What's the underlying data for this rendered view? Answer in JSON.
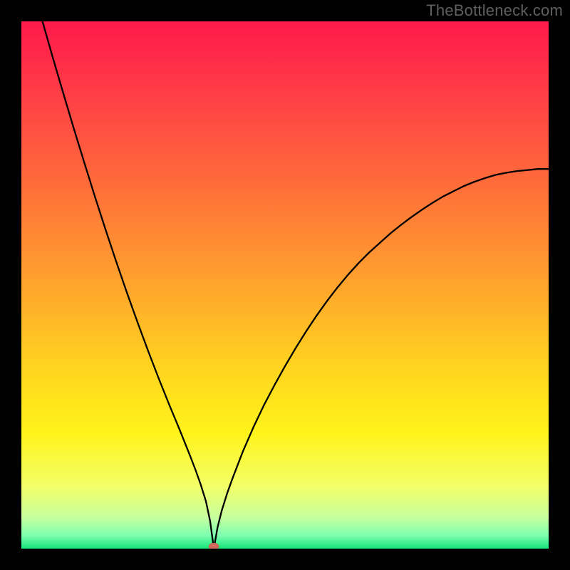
{
  "watermark": "TheBottleneck.com",
  "colors": {
    "frame_bg": "#000000",
    "watermark_text": "#5f5f5f",
    "curve_stroke": "#000000",
    "marker_fill": "#d16a5f",
    "marker_stroke": "#c2564a",
    "gradient_stops": [
      {
        "offset": 0.0,
        "color": "#ff1a4b"
      },
      {
        "offset": 0.13,
        "color": "#ff3b47"
      },
      {
        "offset": 0.3,
        "color": "#ff6a3a"
      },
      {
        "offset": 0.48,
        "color": "#ff9e2f"
      },
      {
        "offset": 0.65,
        "color": "#ffd21f"
      },
      {
        "offset": 0.78,
        "color": "#fff31a"
      },
      {
        "offset": 0.88,
        "color": "#f4ff66"
      },
      {
        "offset": 0.94,
        "color": "#c8ff9e"
      },
      {
        "offset": 0.975,
        "color": "#7dffb0"
      },
      {
        "offset": 1.0,
        "color": "#16e47a"
      }
    ]
  },
  "chart_data": {
    "type": "line",
    "title": "",
    "xlabel": "",
    "ylabel": "",
    "xlim": [
      0,
      1
    ],
    "ylim": [
      0,
      1
    ],
    "minimum": {
      "x": 0.365,
      "y": 0.0
    },
    "left_branch_top": {
      "x": 0.04,
      "y": 1.0
    },
    "right_branch_end": {
      "x": 1.0,
      "y": 0.72
    },
    "series": [
      {
        "name": "bottleneck-curve",
        "x": [
          0.04,
          0.06,
          0.08,
          0.1,
          0.12,
          0.14,
          0.16,
          0.18,
          0.2,
          0.22,
          0.24,
          0.26,
          0.28,
          0.3,
          0.32,
          0.33,
          0.34,
          0.35,
          0.358,
          0.365,
          0.372,
          0.38,
          0.39,
          0.4,
          0.42,
          0.44,
          0.46,
          0.48,
          0.5,
          0.52,
          0.54,
          0.56,
          0.58,
          0.6,
          0.62,
          0.64,
          0.66,
          0.68,
          0.7,
          0.72,
          0.74,
          0.76,
          0.78,
          0.8,
          0.82,
          0.84,
          0.86,
          0.88,
          0.9,
          0.92,
          0.94,
          0.96,
          0.98,
          1.0
        ],
        "y": [
          1.0,
          0.93,
          0.862,
          0.795,
          0.73,
          0.666,
          0.604,
          0.544,
          0.486,
          0.43,
          0.376,
          0.324,
          0.274,
          0.226,
          0.176,
          0.15,
          0.122,
          0.09,
          0.052,
          0.0,
          0.04,
          0.072,
          0.104,
          0.132,
          0.184,
          0.23,
          0.272,
          0.31,
          0.346,
          0.38,
          0.412,
          0.442,
          0.47,
          0.496,
          0.52,
          0.542,
          0.562,
          0.58,
          0.598,
          0.614,
          0.629,
          0.643,
          0.656,
          0.668,
          0.678,
          0.688,
          0.696,
          0.703,
          0.709,
          0.713,
          0.716,
          0.718,
          0.72,
          0.72
        ]
      }
    ]
  }
}
